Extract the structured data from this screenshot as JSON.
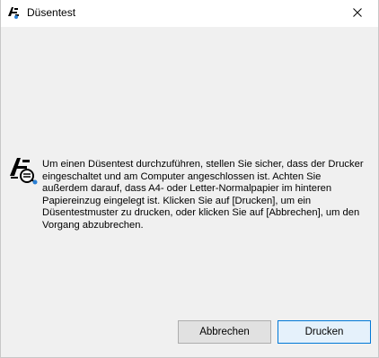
{
  "window": {
    "title": "Düsentest",
    "close_icon": "close-icon",
    "app_icon": "printer-nozzle-check-icon"
  },
  "message": {
    "icon": "nozzle-check-icon",
    "text": "Um einen Düsentest durchzuführen, stellen Sie sicher, dass der Drucker eingeschaltet und am Computer angeschlossen ist. Achten Sie außerdem darauf, dass A4- oder Letter-Normalpapier im hinteren Papiereinzug eingelegt ist. Klicken Sie auf [Drucken], um ein Düsentestmuster zu drucken, oder klicken Sie auf [Abbrechen], um den Vorgang abzubrechen."
  },
  "buttons": {
    "cancel_label": "Abbrechen",
    "print_label": "Drucken"
  },
  "colors": {
    "default_button_border": "#0078d7",
    "dialog_background": "#f0f0f0"
  }
}
